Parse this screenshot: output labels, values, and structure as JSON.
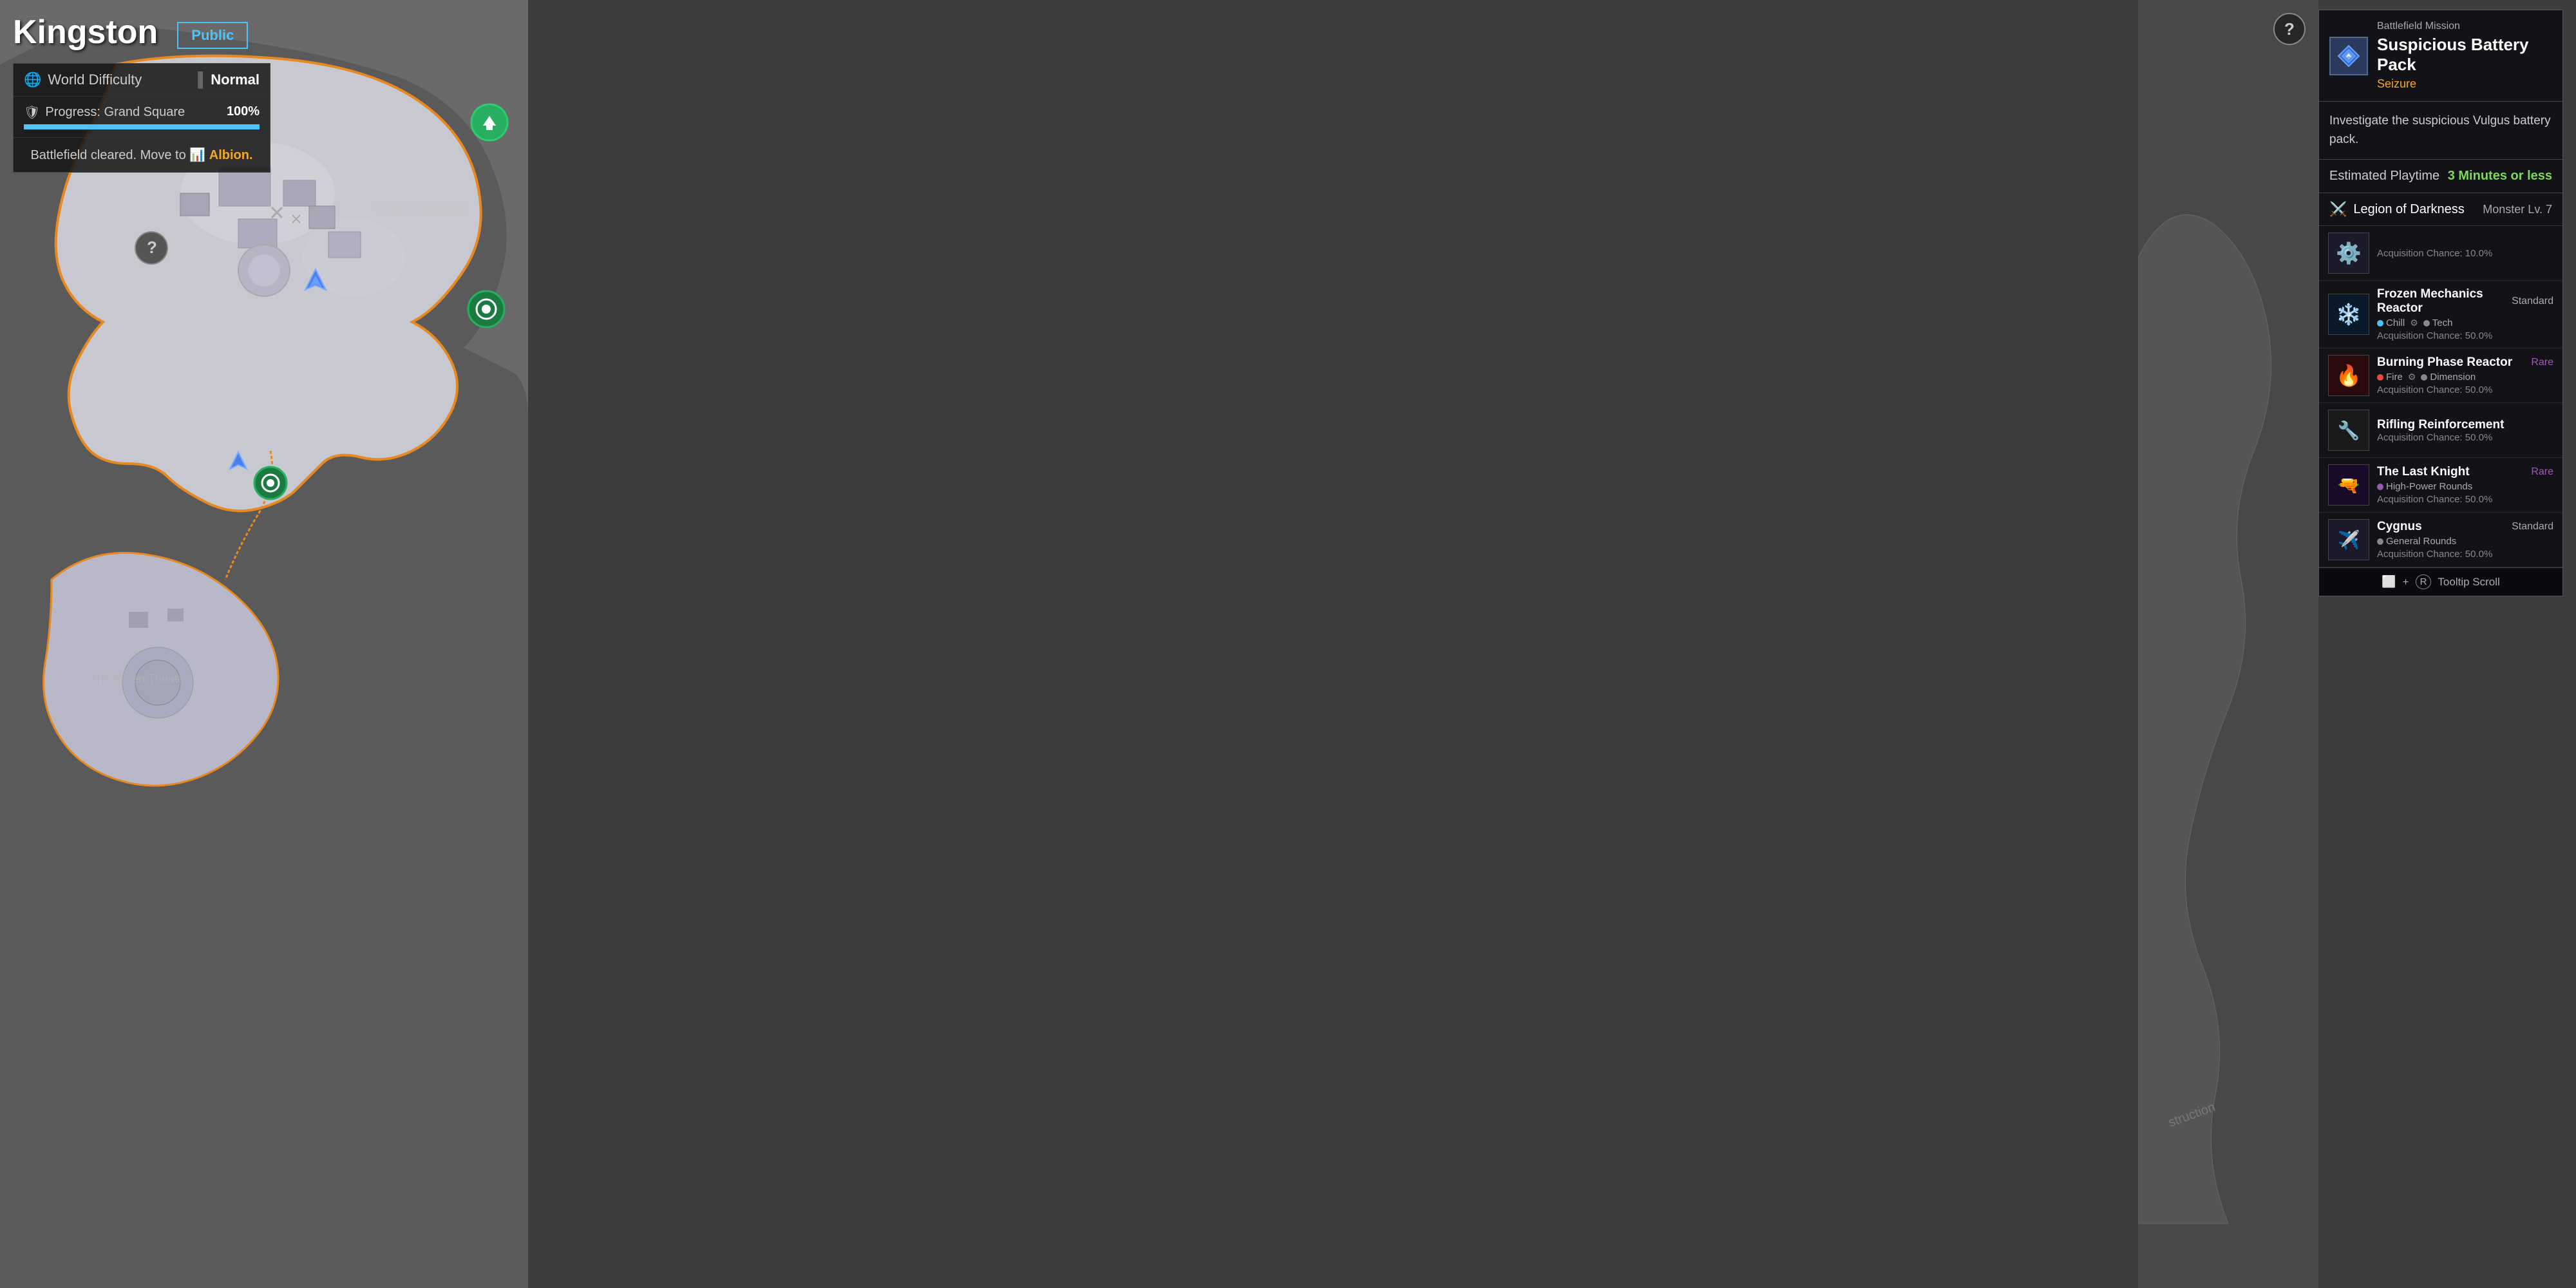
{
  "location": {
    "name": "Kingston",
    "visibility": "Public"
  },
  "left_panel": {
    "world_difficulty_label": "World Difficulty",
    "world_difficulty_value": "Normal",
    "progress_label": "Progress: Grand Square",
    "progress_percent": "100%",
    "progress_value": 100,
    "battlefield_notice": "Battlefield cleared. Move to",
    "next_location": "Albion."
  },
  "mission_panel": {
    "mission_type": "Battlefield Mission",
    "mission_name": "Suspicious Battery Pack",
    "mission_tag": "Seizure",
    "description": "Investigate the suspicious Vulgus battery pack.",
    "playtime_label": "Estimated Playtime",
    "playtime_value": "3 Minutes or less",
    "enemy_faction": "Legion of Darkness",
    "enemy_level": "Monster Lv. 7",
    "loot_items": [
      {
        "name": "",
        "rarity": "",
        "tags": [],
        "chance": "Acquisition Chance: 10.0%",
        "thumb_type": "gear"
      },
      {
        "name": "Frozen Mechanics Reactor",
        "rarity": "Standard",
        "tags": [
          {
            "icon": "❄️",
            "label": "Chill",
            "dot": "blue"
          },
          {
            "icon": "⚙️",
            "label": "Tech",
            "dot": "gray"
          }
        ],
        "chance": "Acquisition Chance: 50.0%",
        "thumb_type": "reactor-frozen"
      },
      {
        "name": "Burning Phase Reactor",
        "rarity": "Rare",
        "tags": [
          {
            "icon": "🔴",
            "label": "Fire",
            "dot": "red"
          },
          {
            "icon": "⚙️",
            "label": "Dimension",
            "dot": "gray"
          }
        ],
        "chance": "Acquisition Chance: 50.0%",
        "thumb_type": "reactor-burning"
      },
      {
        "name": "Rifling Reinforcement",
        "rarity": "",
        "tags": [],
        "chance": "Acquisition Chance: 50.0%",
        "thumb_type": "rifle"
      },
      {
        "name": "The Last Knight",
        "rarity": "Rare",
        "tags": [
          {
            "icon": "🟣",
            "label": "High-Power Rounds",
            "dot": "purple"
          }
        ],
        "chance": "Acquisition Chance: 50.0%",
        "thumb_type": "knight"
      },
      {
        "name": "Cygnus",
        "rarity": "Standard",
        "tags": [
          {
            "icon": "⬜",
            "label": "General Rounds",
            "dot": "gray"
          }
        ],
        "chance": "Acquisition Chance: 50.0%",
        "thumb_type": "cygnus"
      }
    ],
    "tooltip_scroll": "Tooltip Scroll"
  },
  "map_labels": {
    "grand_square": "Grand Square",
    "fallen_theater": "The Fallen Theater",
    "construction": "struction"
  },
  "help_button_label": "?"
}
